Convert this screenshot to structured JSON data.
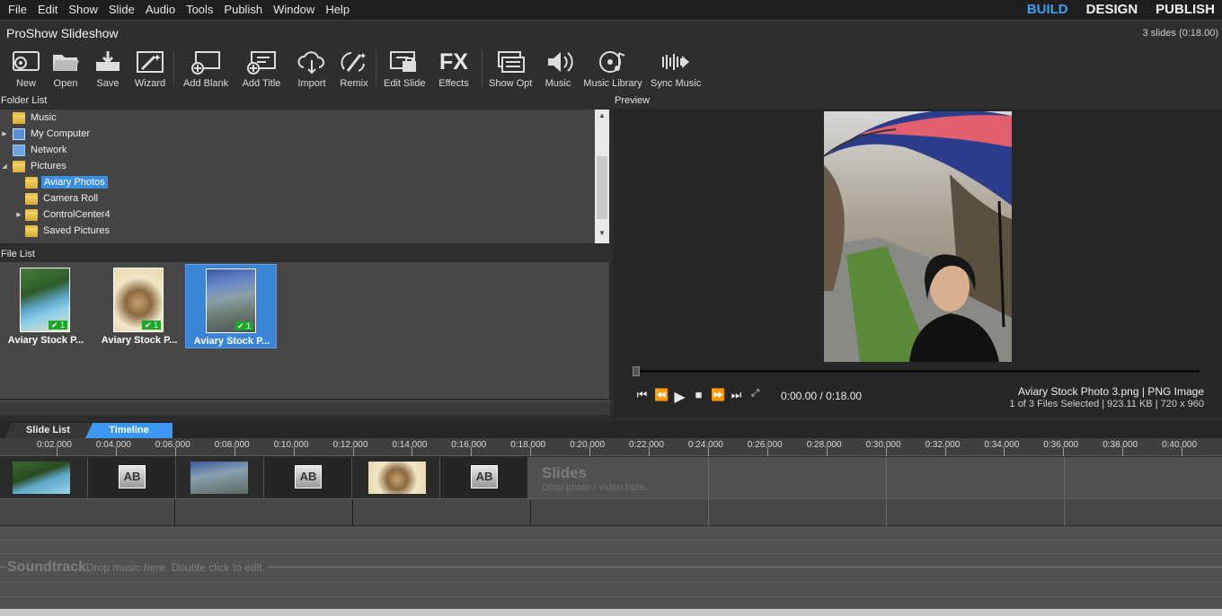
{
  "menu": [
    "File",
    "Edit",
    "Show",
    "Slide",
    "Audio",
    "Tools",
    "Publish",
    "Window",
    "Help"
  ],
  "modes": [
    "BUILD",
    "DESIGN",
    "PUBLISH"
  ],
  "window": {
    "title": "ProShow Slideshow",
    "slide_count": "3 slides (0:18.00)"
  },
  "toolbar": {
    "new": "New",
    "open": "Open",
    "save": "Save",
    "wizard": "Wizard",
    "add_blank": "Add Blank",
    "add_title": "Add Title",
    "import": "Import",
    "remix": "Remix",
    "edit_slide": "Edit Slide",
    "effects": "Effects",
    "show_opt": "Show Opt",
    "music": "Music",
    "music_library": "Music Library",
    "sync_music": "Sync Music",
    "fx_glyph": "FX"
  },
  "folder_list": {
    "header": "Folder List",
    "items": [
      "Music",
      "My Computer",
      "Network",
      "Pictures",
      "Aviary Photos",
      "Camera Roll",
      "ControlCenter4",
      "Saved Pictures"
    ]
  },
  "file_list": {
    "header": "File List",
    "files": [
      {
        "name": "Aviary Stock P...",
        "count": "1"
      },
      {
        "name": "Aviary Stock P...",
        "count": "1"
      },
      {
        "name": "Aviary Stock P...",
        "count": "1"
      }
    ]
  },
  "preview": {
    "header": "Preview",
    "time": "0:00.00 / 0:18.00",
    "file_info": "Aviary Stock Photo 3.png  |  PNG Image",
    "file_detail": "1 of 3 Files Selected  |  923.11 KB  |  720 x 960"
  },
  "tabs": {
    "slide_list": "Slide List",
    "timeline": "Timeline"
  },
  "ruler": [
    "0:02.000",
    "0:04.000",
    "0:06.000",
    "0:08.000",
    "0:10.000",
    "0:12.000",
    "0:14.000",
    "0:16.000",
    "0:18.000",
    "0:20.000",
    "0:22.000",
    "0:24.000",
    "0:26.000",
    "0:28.000",
    "0:30.000",
    "0:32.000",
    "0:34.000",
    "0:36.000",
    "0:38.000",
    "0:40.000"
  ],
  "slides_track": {
    "title": "Slides",
    "hint": "Drop photo / video here.",
    "transition_glyph": "AB"
  },
  "soundtrack": {
    "title": "Soundtrack",
    "hint": "Drop music here.  Double click to edit."
  },
  "colors": {
    "accent": "#3a98f2",
    "background": "#2b2b2b",
    "badge": "#1ba52b"
  }
}
